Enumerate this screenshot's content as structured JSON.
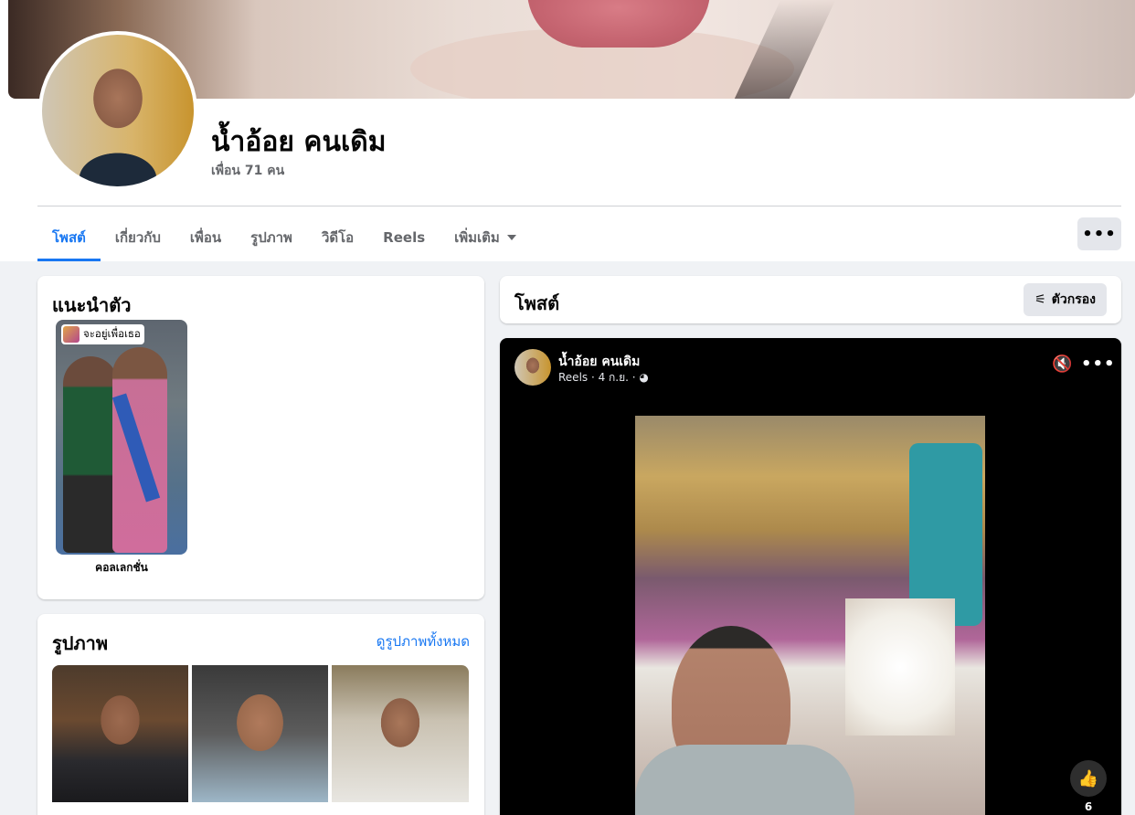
{
  "profile": {
    "name": "น้ำอ้อย คนเดิม",
    "friends": "เพื่อน 71 คน"
  },
  "tabs": [
    {
      "label": "โพสต์",
      "active": true
    },
    {
      "label": "เกี่ยวกับ",
      "active": false
    },
    {
      "label": "เพื่อน",
      "active": false
    },
    {
      "label": "รูปภาพ",
      "active": false
    },
    {
      "label": "วิดีโอ",
      "active": false
    },
    {
      "label": "Reels",
      "active": false
    },
    {
      "label": "เพิ่มเติม",
      "active": false
    }
  ],
  "more_button": "•••",
  "intro": {
    "title": "แนะนำตัว",
    "story_tag": "จะอยู่เพื่อเธอ",
    "collection_label": "คอลเลกชั่น"
  },
  "photos": {
    "title": "รูปภาพ",
    "see_all": "ดูรูปภาพทั้งหมด"
  },
  "posts": {
    "title": "โพสต์",
    "filter_label": "ตัวกรอง"
  },
  "reel": {
    "author": "น้ำอ้อย คนเดิม",
    "meta": "Reels · 4 ก.ย. · ◕",
    "like_count": "6"
  },
  "colors": {
    "accent": "#1877f2",
    "background": "#f0f2f5",
    "muted_text": "#65676b"
  }
}
